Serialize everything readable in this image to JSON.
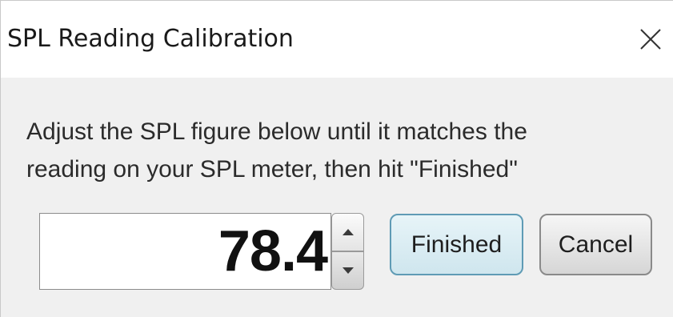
{
  "window": {
    "title": "SPL Reading Calibration",
    "close_icon": "close-icon"
  },
  "instruction": {
    "line1": "Adjust the SPL figure below until it matches the",
    "line2": "reading on your SPL meter, then hit \"Finished\""
  },
  "spl_input": {
    "value": "78.4",
    "up_icon": "chevron-up-icon",
    "down_icon": "chevron-down-icon"
  },
  "buttons": {
    "finished_label": "Finished",
    "cancel_label": "Cancel"
  },
  "colors": {
    "finished_border": "#5f9bb5",
    "finished_fill": "#d8ecf2",
    "dialog_background": "#f0f0f0"
  }
}
